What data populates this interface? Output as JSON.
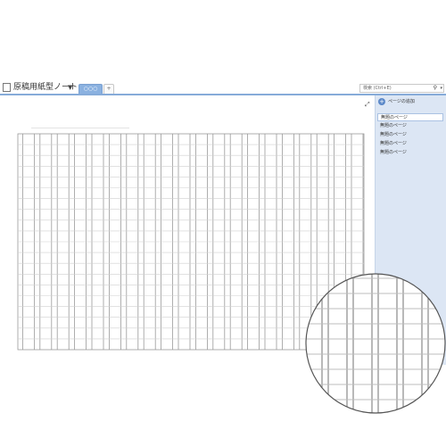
{
  "notebook": {
    "title": "原稿用紙型ノート",
    "dropdown_icon": "caret-down-icon"
  },
  "tabs": [
    {
      "label": "○○○",
      "active": true
    },
    {
      "label": "+",
      "active": false
    }
  ],
  "search": {
    "placeholder": "検索 (Ctrl+E)",
    "icon": "magnifier-icon",
    "dropdown_icon": "caret-down-icon"
  },
  "page_panel": {
    "add_page_label": "ページの追加",
    "pages": [
      {
        "label": "無題のページ",
        "selected": true
      },
      {
        "label": "無題のページ",
        "selected": false
      },
      {
        "label": "無題のページ",
        "selected": false
      },
      {
        "label": "無題のページ",
        "selected": false
      },
      {
        "label": "無題のページ",
        "selected": false
      }
    ]
  },
  "colors": {
    "accent": "#86abd9",
    "tab_active": "#8ab1e0",
    "panel_bg": "#dce6f4",
    "grid_line": "#9a9a9a"
  }
}
